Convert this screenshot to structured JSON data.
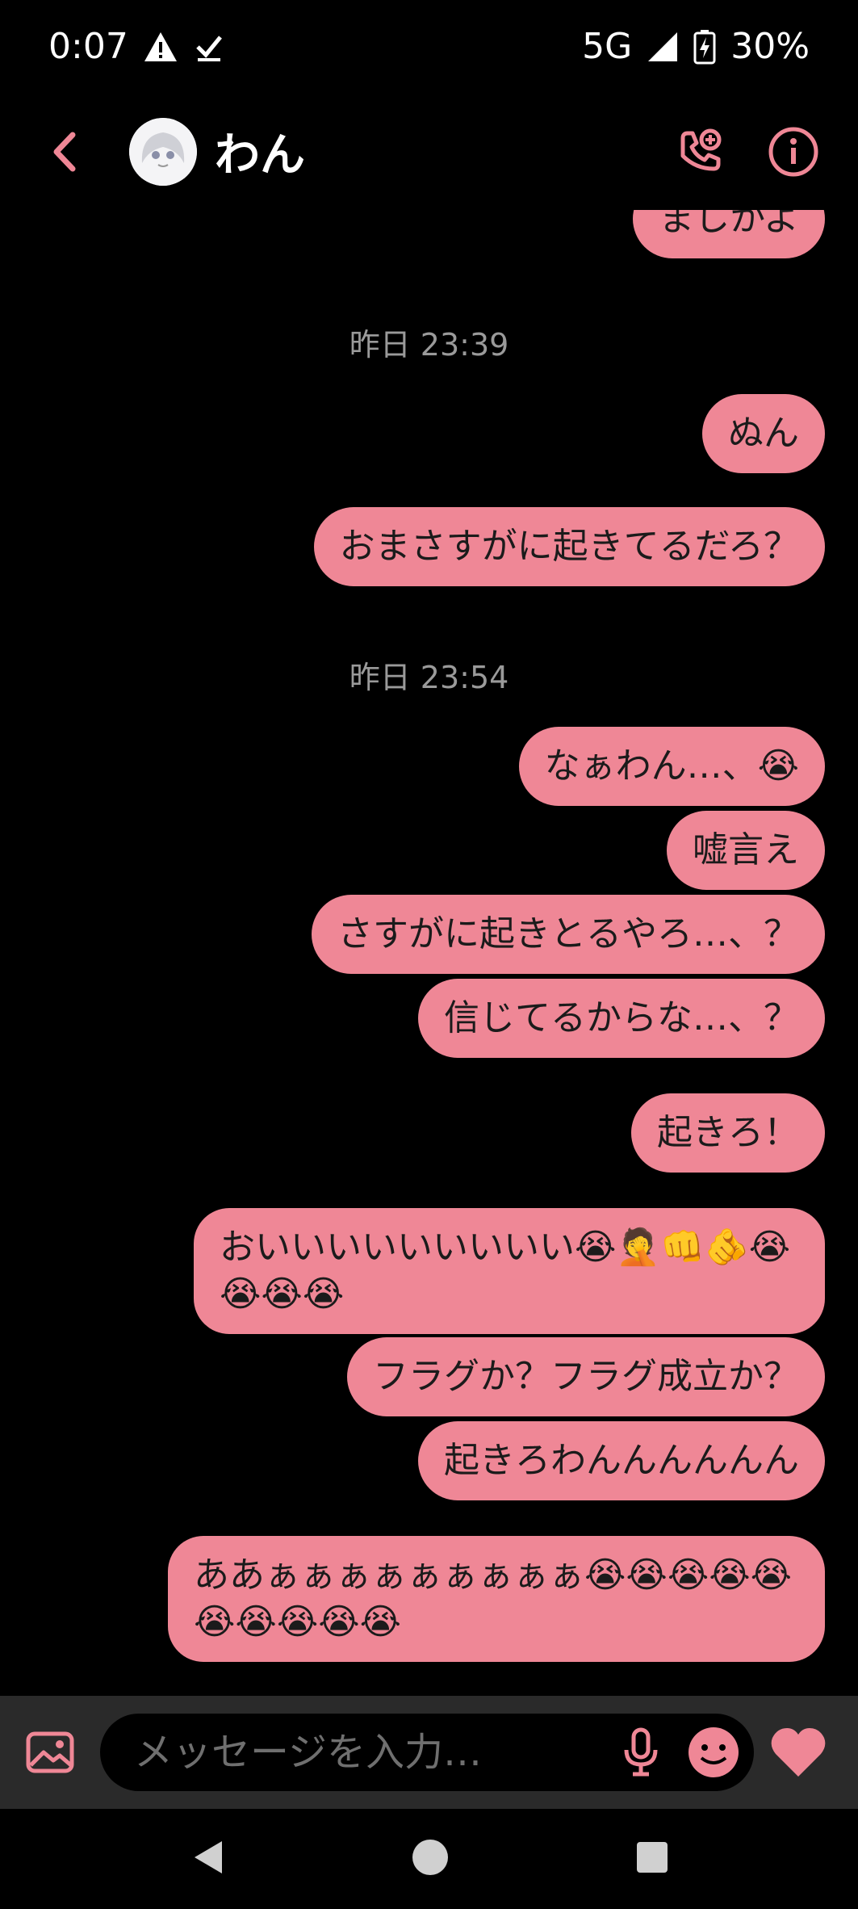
{
  "status_bar": {
    "time": "0:07",
    "network": "5G",
    "battery": "30%"
  },
  "header": {
    "contact_name": "わん"
  },
  "chat": {
    "top_partial_message": "ましかよ",
    "sep1": "昨日 23:39",
    "msg_nun": "ぬん",
    "msg_omasa": "おまさすがに起きてるだろ？",
    "sep2": "昨日 23:54",
    "msg_naa": "なぁわん…、😭",
    "msg_uso": "嘘言え",
    "msg_sasuga": "さすがに起きとるやろ…、？",
    "msg_shinjiteru": "信じてるからな…、？",
    "msg_okiro": "起きろ！",
    "msg_oiii": "おいいいいいいいいい😭🤦👊🫵😭😭😭😭",
    "msg_flag": "フラグか？フラグ成立か？",
    "msg_okiro_wan": "起きろわんんんんんん",
    "msg_aaa": "ああぁぁぁぁぁぁぁぁぁ😭😭😭😭😭😭😭😭😭😭"
  },
  "composer": {
    "placeholder": "メッセージを入力…"
  },
  "colors": {
    "accent": "#ef8796",
    "background": "#000000",
    "composer": "#2a2a2a"
  },
  "icons": [
    "back-chevron-icon",
    "avatar",
    "add-call-icon",
    "info-icon",
    "gallery-icon",
    "mic-icon",
    "emoji-icon",
    "heart-icon",
    "nav-back-icon",
    "nav-home-icon",
    "nav-recents-icon"
  ]
}
